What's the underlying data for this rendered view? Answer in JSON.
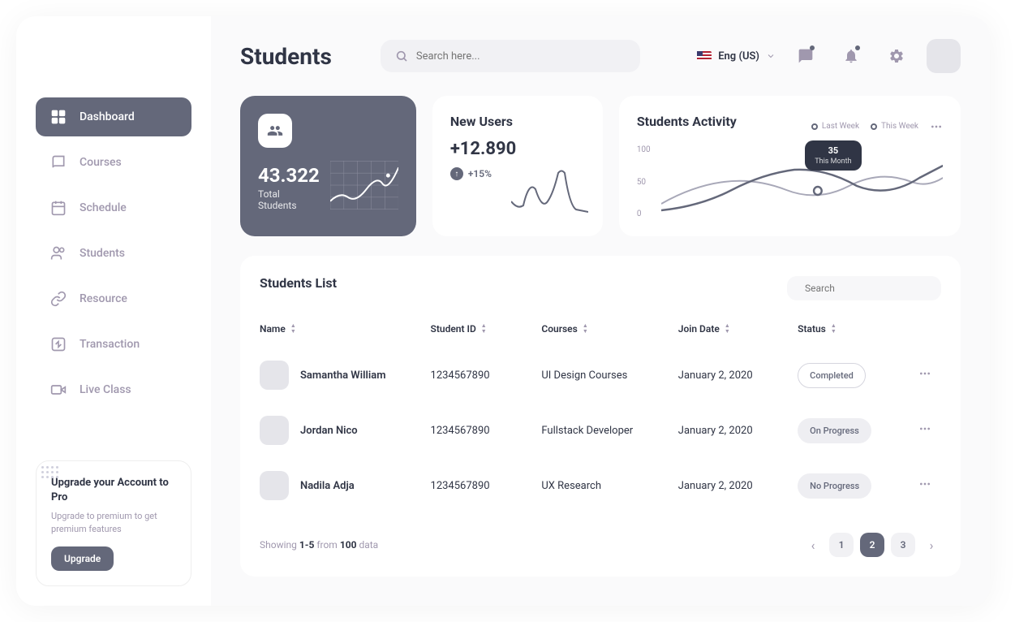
{
  "header": {
    "title": "Students",
    "search_placeholder": "Search here...",
    "language": "Eng (US)"
  },
  "sidebar": {
    "items": [
      {
        "label": "Dashboard",
        "icon": "grid-icon",
        "active": true
      },
      {
        "label": "Courses",
        "icon": "book-icon"
      },
      {
        "label": "Schedule",
        "icon": "calendar-icon"
      },
      {
        "label": "Students",
        "icon": "users-icon"
      },
      {
        "label": "Resource",
        "icon": "link-icon"
      },
      {
        "label": "Transaction",
        "icon": "transfer-icon"
      },
      {
        "label": "Live Class",
        "icon": "video-icon"
      }
    ],
    "upgrade": {
      "title": "Upgrade your Account to Pro",
      "desc": "Upgrade to premium to get premium features",
      "button": "Upgrade"
    }
  },
  "stats": {
    "total_students": {
      "value": "43.322",
      "label": "Total Students"
    },
    "new_users": {
      "title": "New Users",
      "value": "+12.890",
      "delta": "+15%"
    }
  },
  "activity": {
    "title": "Students Activity",
    "legend": [
      "Last Week",
      "This Week"
    ],
    "tooltip": {
      "value": "35",
      "label": "This Month"
    },
    "y_ticks": [
      "100",
      "50",
      "0"
    ]
  },
  "chart_data": [
    {
      "type": "line",
      "title": "Total Students (spark)",
      "x": [
        0,
        1,
        2,
        3,
        4,
        5,
        6,
        7
      ],
      "values": [
        30,
        42,
        35,
        48,
        40,
        55,
        52,
        78
      ]
    },
    {
      "type": "line",
      "title": "New Users (spark)",
      "x": [
        0,
        1,
        2,
        3,
        4,
        5,
        6
      ],
      "values": [
        40,
        15,
        55,
        25,
        35,
        85,
        30
      ]
    },
    {
      "type": "line",
      "title": "Students Activity",
      "ylim": [
        0,
        100
      ],
      "x": [
        0,
        1,
        2,
        3,
        4,
        5,
        6,
        7,
        8
      ],
      "series": [
        {
          "name": "Last Week",
          "values": [
            20,
            35,
            60,
            55,
            40,
            35,
            50,
            70,
            55
          ]
        },
        {
          "name": "This Week",
          "values": [
            10,
            25,
            40,
            65,
            70,
            60,
            45,
            55,
            75
          ]
        }
      ],
      "tooltip_point": {
        "x": 4.5,
        "value": 35,
        "label": "This Month"
      }
    }
  ],
  "list": {
    "title": "Students List",
    "search_placeholder": "Search",
    "columns": [
      "Name",
      "Student ID",
      "Courses",
      "Join Date",
      "Status"
    ],
    "rows": [
      {
        "name": "Samantha William",
        "id": "1234567890",
        "course": "UI Design Courses",
        "date": "January 2, 2020",
        "status": "Completed",
        "status_class": ""
      },
      {
        "name": "Jordan Nico",
        "id": "1234567890",
        "course": "Fullstack Developer",
        "date": "January 2, 2020",
        "status": "On Progress",
        "status_class": "prog"
      },
      {
        "name": "Nadila Adja",
        "id": "1234567890",
        "course": "UX Research",
        "date": "January 2, 2020",
        "status": "No Progress",
        "status_class": "prog"
      }
    ],
    "pagination": {
      "info_prefix": "Showing ",
      "range": "1-5",
      "info_mid": " from ",
      "total": "100",
      "info_suffix": " data",
      "pages": [
        "1",
        "2",
        "3"
      ],
      "active": 1
    }
  }
}
